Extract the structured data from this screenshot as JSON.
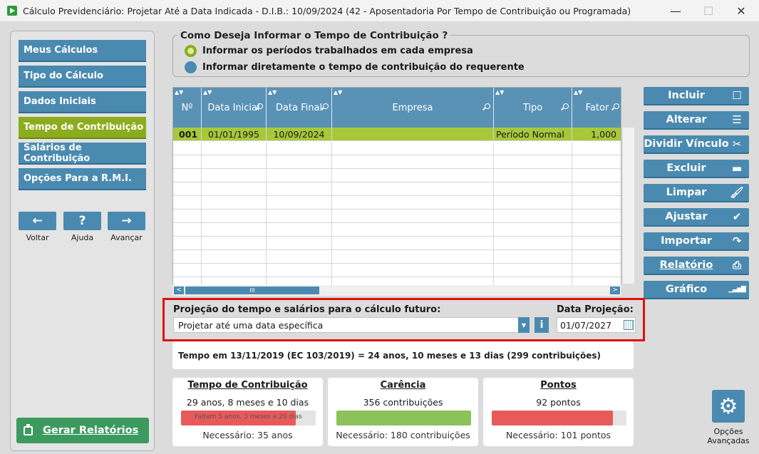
{
  "window": {
    "title": "Cálculo Previdenciário: Projetar Até a Data Indicada - D.I.B.: 10/09/2024 (42 - Aposentadoria Por Tempo de Contribuição ou Programada)",
    "minimize": "—",
    "maximize": "☐",
    "close": "✕"
  },
  "sidebar": {
    "items": [
      {
        "label": "Meus Cálculos"
      },
      {
        "label": "Tipo do Cálculo"
      },
      {
        "label": "Dados Iniciais"
      },
      {
        "label": "Tempo de Contribuição"
      },
      {
        "label": "Salários de Contribuição"
      },
      {
        "label": "Opções Para a R.M.I."
      }
    ],
    "active_index": 3,
    "nav": {
      "back_icon": "←",
      "back_label": "Voltar",
      "help_icon": "?",
      "help_label": "Ajuda",
      "next_icon": "→",
      "next_label": "Avançar"
    },
    "report_button": "Gerar Relatórios"
  },
  "radio_group": {
    "legend": "Como Deseja Informar o Tempo de Contribuição ?",
    "options": [
      {
        "label": "Informar os períodos trabalhados em cada empresa",
        "selected": true
      },
      {
        "label": "Informar diretamente o tempo de contribuição do requerente",
        "selected": false
      }
    ]
  },
  "table": {
    "columns": [
      "Nº",
      "Data Inicial",
      "Data Final",
      "Empresa",
      "Tipo",
      "Fator"
    ],
    "rows": [
      {
        "num": "001",
        "inicio": "01/01/1995",
        "fim": "10/09/2024",
        "empresa": "",
        "tipo": "Período Normal",
        "fator": "1,000"
      }
    ],
    "empty_rows": 11,
    "hscroll_thumb": "III",
    "hscroll_left": "<",
    "hscroll_right": ">"
  },
  "actions": [
    {
      "label": "Incluir",
      "icon": "square-icon",
      "glyph": "☐"
    },
    {
      "label": "Alterar",
      "icon": "list-edit-icon",
      "glyph": "☰"
    },
    {
      "label": "Dividir Vínculo",
      "icon": "scissors-icon",
      "glyph": "✂"
    },
    {
      "label": "Excluir",
      "icon": "minus-icon",
      "glyph": "▬"
    },
    {
      "label": "Limpar",
      "icon": "brush-icon",
      "glyph": "🖌"
    },
    {
      "label": "Ajustar",
      "icon": "check-icon",
      "glyph": "✔"
    },
    {
      "label": "Importar",
      "icon": "import-arrow-icon",
      "glyph": "↷"
    },
    {
      "label": "Relatório",
      "icon": "printer-icon",
      "glyph": "⎙"
    },
    {
      "label": "Gráfico",
      "icon": "bar-chart-icon",
      "glyph": "▁▃▅▇"
    }
  ],
  "projection": {
    "label": "Projeção do tempo e salários para o cálculo futuro:",
    "selected": "Projetar até uma data específica",
    "info": "i",
    "date_label": "Data Projeção:",
    "date_value": "01/07/2027"
  },
  "tempo_info": "Tempo em 13/11/2019 (EC 103/2019) = 24 anos, 10 meses e 13 dias (299 contribuições)",
  "cards": [
    {
      "title": "Tempo de Contribuição",
      "value": "29 anos, 8 meses e 10 dias",
      "bar_text": "Faltam 5 anos, 3 meses e 20 dias",
      "progress": 0.85,
      "color": "#e85a5a",
      "required": "Necessário: 35 anos"
    },
    {
      "title": "Carência",
      "value": "356 contribuições",
      "bar_text": "",
      "progress": 1.0,
      "color": "#8dc15a",
      "required": "Necessário: 180 contribuições"
    },
    {
      "title": "Pontos",
      "value": "92 pontos",
      "bar_text": "",
      "progress": 0.9,
      "color": "#e85a5a",
      "required": "Necessário: 101 pontos"
    }
  ],
  "advanced": {
    "label_line1": "Opções",
    "label_line2": "Avançadas",
    "icon": "gears-icon"
  },
  "colors": {
    "accent": "#4a8ab0",
    "active": "#8cac1e",
    "highlight": "#e01010",
    "selected_row": "#a8c83a"
  }
}
